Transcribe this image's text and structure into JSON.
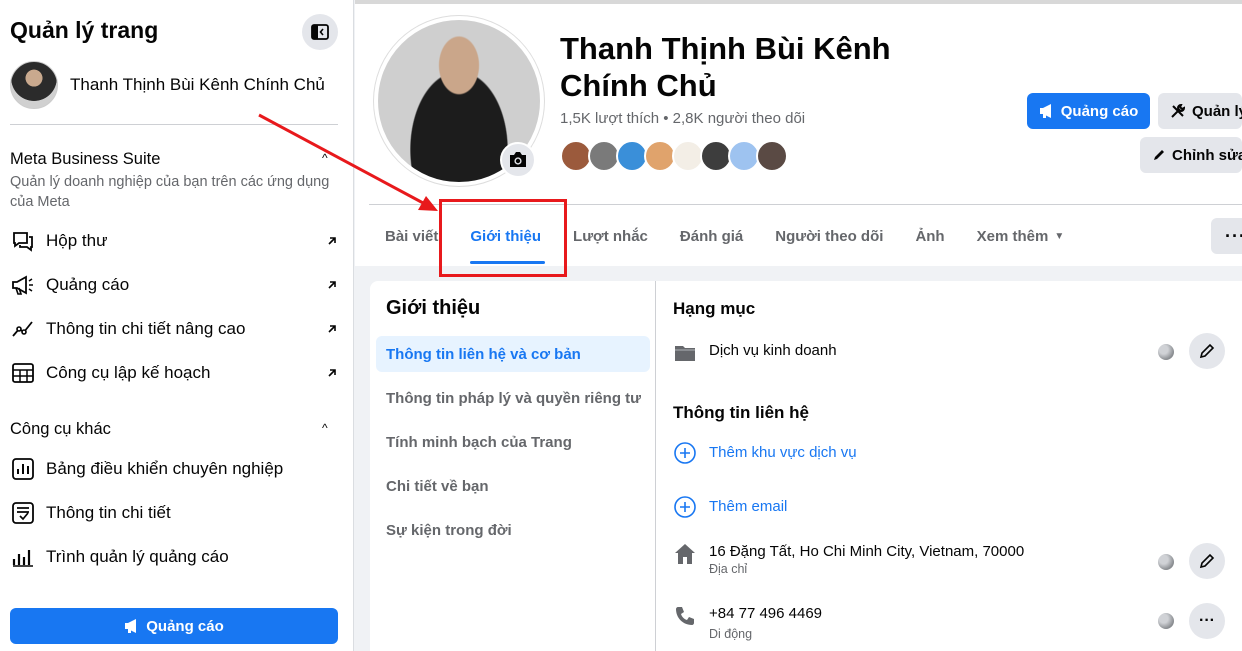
{
  "sidebar": {
    "title": "Quản lý trang",
    "profile_name": "Thanh Thịnh Bùi Kênh Chính Chủ",
    "meta_suite": {
      "title": "Meta Business Suite",
      "description": "Quản lý doanh nghiệp của bạn trên các ứng dụng của Meta",
      "items": [
        {
          "label": "Hộp thư",
          "icon": "inbox-icon"
        },
        {
          "label": "Quảng cáo",
          "icon": "megaphone-icon"
        },
        {
          "label": "Thông tin chi tiết nâng cao",
          "icon": "insights-icon"
        },
        {
          "label": "Công cụ lập kế hoạch",
          "icon": "planner-icon"
        }
      ]
    },
    "other_tools": {
      "title": "Công cụ khác",
      "items": [
        {
          "label": "Bảng điều khiển chuyên nghiệp",
          "icon": "dashboard-icon"
        },
        {
          "label": "Thông tin chi tiết",
          "icon": "details-icon"
        },
        {
          "label": "Trình quản lý quảng cáo",
          "icon": "ads-manager-icon"
        }
      ]
    },
    "ad_button": "Quảng cáo"
  },
  "header": {
    "page_name": "Thanh Thịnh Bùi Kênh Chính Chủ",
    "stats": "1,5K lượt thích • 2,8K người theo dõi",
    "btn_ad": "Quảng cáo",
    "btn_manage": "Quản lý",
    "btn_edit": "Chỉnh sửa",
    "tabs": [
      "Bài viết",
      "Giới thiệu",
      "Lượt nhắc",
      "Đánh giá",
      "Người theo dõi",
      "Ảnh",
      "Xem thêm"
    ],
    "active_tab": "Giới thiệu"
  },
  "about": {
    "title": "Giới thiệu",
    "nav": [
      "Thông tin liên hệ và cơ bản",
      "Thông tin pháp lý và quyền riêng tư",
      "Tính minh bạch của Trang",
      "Chi tiết về bạn",
      "Sự kiện trong đời"
    ],
    "category_heading": "Hạng mục",
    "category_value": "Dịch vụ kinh doanh",
    "contact_heading": "Thông tin liên hệ",
    "add_service_area": "Thêm khu vực dịch vụ",
    "add_email": "Thêm email",
    "address": "16 Đặng Tất, Ho Chi Minh City, Vietnam, 70000",
    "address_label": "Địa chỉ",
    "phone": "+84 77 496 4469",
    "phone_label": "Di động"
  },
  "colors": {
    "accent": "#1877f2",
    "annotation": "#e8191c"
  }
}
